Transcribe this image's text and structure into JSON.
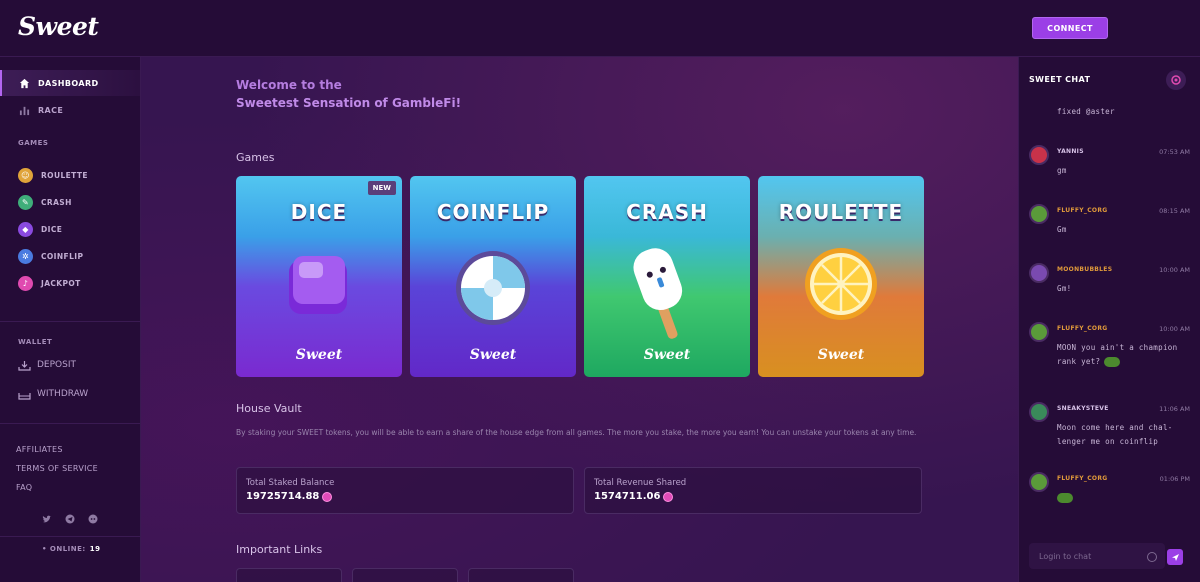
{
  "header": {
    "logo": "Sweet",
    "connect_label": "CONNECT"
  },
  "sidebar": {
    "nav": [
      {
        "label": "DASHBOARD",
        "icon": "home-icon",
        "active": true
      },
      {
        "label": "RACE",
        "icon": "bar-chart-icon",
        "active": false
      }
    ],
    "games_label": "GAMES",
    "games": [
      {
        "label": "ROULETTE",
        "icon": "roulette-icon",
        "color": "#e0a43a"
      },
      {
        "label": "CRASH",
        "icon": "crash-icon",
        "color": "#3fae7a"
      },
      {
        "label": "DICE",
        "icon": "dice-icon",
        "color": "#8a4ae0"
      },
      {
        "label": "COINFLIP",
        "icon": "coinflip-icon",
        "color": "#4a7be0"
      },
      {
        "label": "JACKPOT",
        "icon": "jackpot-icon",
        "color": "#e04ab0"
      }
    ],
    "wallet_label": "WALLET",
    "wallet": [
      {
        "label": "DEPOSIT",
        "icon": "deposit-icon"
      },
      {
        "label": "WITHDRAW",
        "icon": "withdraw-icon"
      }
    ],
    "footer_links": [
      "AFFILIATES",
      "TERMS OF SERVICE",
      "FAQ"
    ],
    "socials": [
      "twitter-icon",
      "telegram-icon",
      "discord-icon"
    ],
    "online_label": "• ONLINE:",
    "online_count": "19"
  },
  "main": {
    "welcome_line1": "Welcome to the",
    "welcome_line2": "Sweetest Sensation of GambleFi!",
    "games_title": "Games",
    "cards": [
      {
        "title": "DICE",
        "brand": "Sweet",
        "badge": "NEW"
      },
      {
        "title": "COINFLIP",
        "brand": "Sweet",
        "badge": ""
      },
      {
        "title": "CRASH",
        "brand": "Sweet",
        "badge": ""
      },
      {
        "title": "ROULETTE",
        "brand": "Sweet",
        "badge": ""
      }
    ],
    "vault_title": "House Vault",
    "vault_desc": "By staking your SWEET tokens, you will be able to earn a share of the house edge from all games. The more you stake, the more you earn! You can unstake your tokens at any time.",
    "stats": [
      {
        "label": "Total Staked Balance",
        "value": "19725714.88"
      },
      {
        "label": "Total Revenue Shared",
        "value": "1574711.06"
      }
    ],
    "links_title": "Important Links"
  },
  "chat": {
    "title": "SWEET CHAT",
    "messages": [
      {
        "user": "",
        "time": "",
        "text": "fixed @aster",
        "user_color": "#c8b6d6"
      },
      {
        "user": "YANNIS",
        "time": "07:53 AM",
        "text": "gm",
        "user_color": "#d8c3e8"
      },
      {
        "user": "FLUFFY_CORG",
        "time": "08:15 AM",
        "text": "Gm",
        "user_color": "#e09a3a"
      },
      {
        "user": "MOONBUBBLES",
        "time": "10:00 AM",
        "text": "Gm!",
        "user_color": "#e09a3a"
      },
      {
        "user": "FLUFFY_CORG",
        "time": "10:00 AM",
        "text": "MOON you ain't a champion rank yet?",
        "user_color": "#e09a3a"
      },
      {
        "user": "SNEAKYSTEVE",
        "time": "11:06 AM",
        "text": "Moon come here and chal- lenger me on coinflip",
        "user_color": "#d8c3e8"
      },
      {
        "user": "FLUFFY_CORG",
        "time": "01:06 PM",
        "text": "",
        "user_color": "#e09a3a"
      }
    ],
    "input_placeholder": "Login to chat"
  }
}
